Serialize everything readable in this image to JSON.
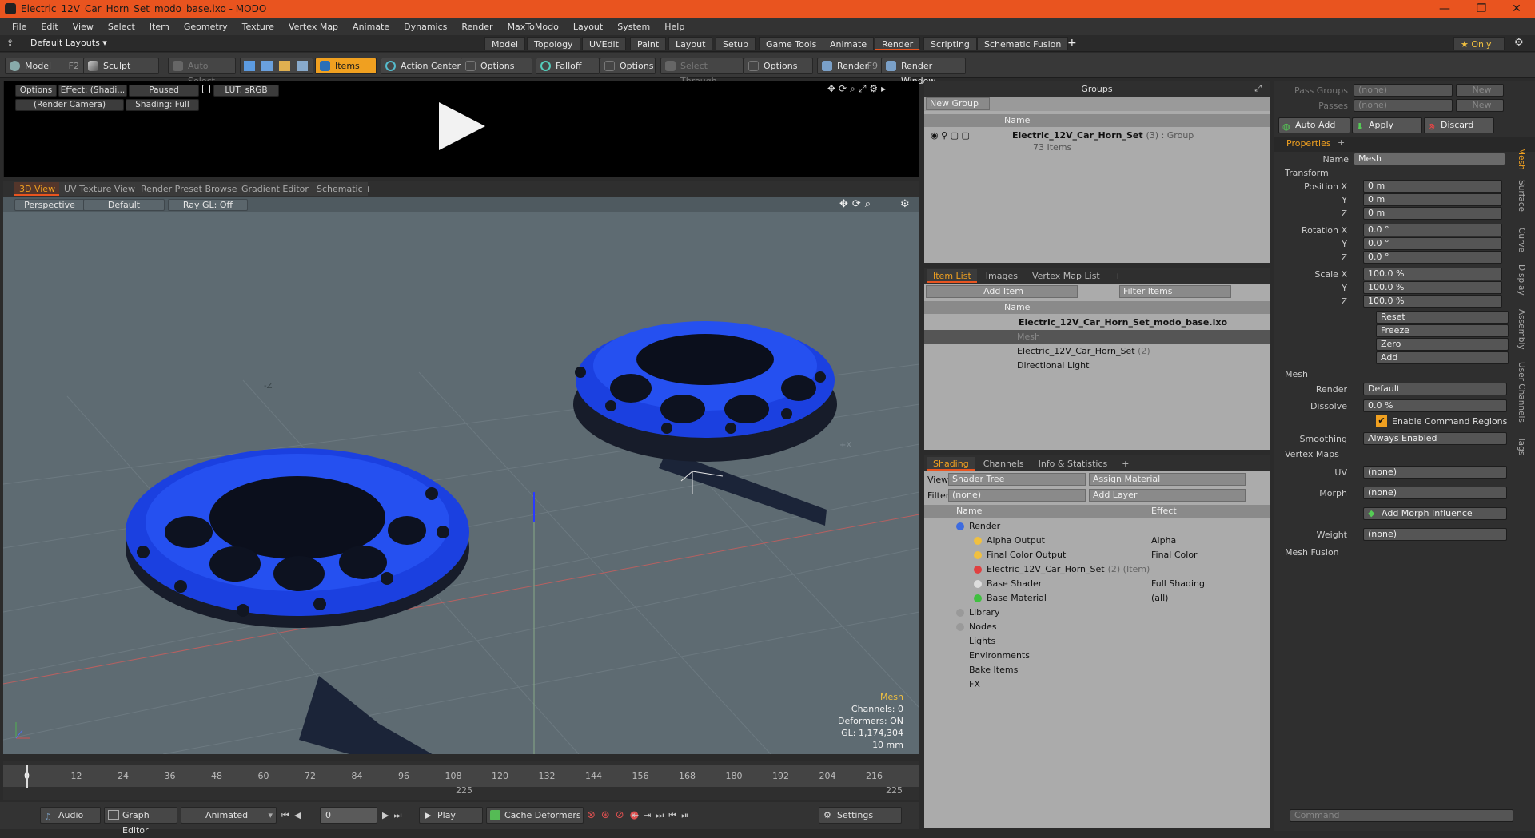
{
  "window": {
    "title": "Electric_12V_Car_Horn_Set_modo_base.lxo - MODO",
    "controls": [
      "—",
      "❐",
      "✕"
    ]
  },
  "menu": [
    "File",
    "Edit",
    "View",
    "Select",
    "Item",
    "Geometry",
    "Texture",
    "Vertex Map",
    "Animate",
    "Dynamics",
    "Render",
    "MaxToModo",
    "Layout",
    "System",
    "Help"
  ],
  "layout": {
    "preset": "Default Layouts ▾",
    "tabs": [
      "Model",
      "Topology",
      "UVEdit",
      "Paint",
      "Layout",
      "Setup",
      "Game Tools",
      "Animate",
      "Render",
      "Scripting",
      "Schematic Fusion"
    ],
    "active": "Render",
    "add": "+",
    "only": "★  Only",
    "gear": "⚙"
  },
  "toolbar": {
    "model": "Model",
    "model_key": "F2",
    "sculpt": "Sculpt",
    "auto_select": "Auto Select",
    "items": "Items",
    "action_center": "Action Center",
    "options1": "Options",
    "falloff": "Falloff",
    "options2": "Options",
    "select_through": "Select Through",
    "options3": "Options",
    "render": "Render",
    "render_key": "F9",
    "render_window": "Render Window"
  },
  "preview": {
    "options": "Options",
    "effect": "Effect: (Shadi...",
    "paused": "Paused",
    "lut": "LUT: sRGB",
    "camera": "(Render Camera)",
    "shading": "Shading: Full"
  },
  "viewtabs": [
    "3D View",
    "UV Texture View",
    "Render Preset Browser",
    "Gradient Editor",
    "Schematic",
    "+"
  ],
  "viewport": {
    "perspective": "Perspective",
    "default": "Default",
    "raygl": "Ray GL: Off",
    "info_title": "Mesh",
    "channels": "Channels: 0",
    "deformers": "Deformers: ON",
    "gl": "GL: 1,174,304",
    "scale": "10 mm",
    "axis_z": "-Z",
    "axis_x": "+X"
  },
  "timeline": {
    "ticks": [
      "0",
      "12",
      "24",
      "36",
      "48",
      "60",
      "72",
      "84",
      "96",
      "108",
      "120",
      "132",
      "144",
      "156",
      "168",
      "180",
      "192",
      "204",
      "216"
    ],
    "end_left": "225",
    "end_right": "225"
  },
  "bottom": {
    "audio": "Audio",
    "graph_editor": "Graph Editor",
    "animated": "Animated",
    "frame": "0",
    "play": "Play",
    "cache": "Cache Deformers",
    "settings": "Settings"
  },
  "groups": {
    "title": "Groups",
    "new_group": "New Group",
    "col_name": "Name",
    "group_name": "Electric_12V_Car_Horn_Set",
    "group_suffix": "(3) : Group",
    "group_items": "73 Items"
  },
  "itemlist": {
    "tabs": [
      "Item List",
      "Images",
      "Vertex Map List",
      "+"
    ],
    "add_item": "Add Item",
    "filter": "Filter Items",
    "col_name": "Name",
    "rows": [
      {
        "name": "Electric_12V_Car_Horn_Set_modo_base.lxo",
        "suffix": ""
      },
      {
        "name": "Mesh",
        "suffix": ""
      },
      {
        "name": "Electric_12V_Car_Horn_Set",
        "suffix": "(2)"
      },
      {
        "name": "Directional Light",
        "suffix": ""
      }
    ]
  },
  "shading": {
    "tabs": [
      "Shading",
      "Channels",
      "Info & Statistics",
      "+"
    ],
    "view_label": "View",
    "view_value": "Shader Tree",
    "assign": "Assign Material",
    "filter_label": "Filter",
    "filter_value": "(none)",
    "add_layer": "Add Layer",
    "col_name": "Name",
    "col_effect": "Effect",
    "rows": [
      {
        "name": "Render",
        "effect": ""
      },
      {
        "name": "Alpha Output",
        "effect": "Alpha"
      },
      {
        "name": "Final Color Output",
        "effect": "Final Color"
      },
      {
        "name": "Electric_12V_Car_Horn_Set",
        "suffix": "(2) (Item)",
        "effect": ""
      },
      {
        "name": "Base Shader",
        "effect": "Full Shading"
      },
      {
        "name": "Base Material",
        "effect": "(all)"
      },
      {
        "name": "Library",
        "effect": ""
      },
      {
        "name": "Nodes",
        "effect": ""
      },
      {
        "name": "Lights",
        "effect": ""
      },
      {
        "name": "Environments",
        "effect": ""
      },
      {
        "name": "Bake Items",
        "effect": ""
      },
      {
        "name": "FX",
        "effect": ""
      }
    ]
  },
  "properties": {
    "pass_groups": "Pass Groups",
    "passes": "Passes",
    "none": "(none)",
    "new": "New",
    "auto_add": "Auto Add",
    "apply": "Apply",
    "discard": "Discard",
    "tab": "Properties",
    "add": "+",
    "name_label": "Name",
    "name_value": "Mesh",
    "transform": "Transform",
    "position_x": "Position X",
    "y": "Y",
    "z": "Z",
    "rotation_x": "Rotation X",
    "scale_x": "Scale X",
    "pos": [
      "0 m",
      "0 m",
      "0 m"
    ],
    "rot": [
      "0.0 °",
      "0.0 °",
      "0.0 °"
    ],
    "scale": [
      "100.0 %",
      "100.0 %",
      "100.0 %"
    ],
    "reset": "Reset",
    "freeze": "Freeze",
    "zero": "Zero",
    "add_btn": "Add",
    "mesh": "Mesh",
    "render_label": "Render",
    "render_value": "Default",
    "dissolve_label": "Dissolve",
    "dissolve_value": "0.0 %",
    "cmd_regions": "Enable Command Regions",
    "smoothing_label": "Smoothing",
    "smoothing_value": "Always Enabled",
    "vertex_maps": "Vertex Maps",
    "uv_label": "UV",
    "uv_value": "(none)",
    "morph_label": "Morph",
    "morph_value": "(none)",
    "add_morph": "Add Morph Influence",
    "weight_label": "Weight",
    "weight_value": "(none)",
    "mesh_fusion": "Mesh Fusion",
    "side_tabs": [
      "Mesh",
      "Surface",
      "Curve",
      "Display",
      "Assembly",
      "User Channels",
      "Tags"
    ],
    "command": "Command"
  }
}
